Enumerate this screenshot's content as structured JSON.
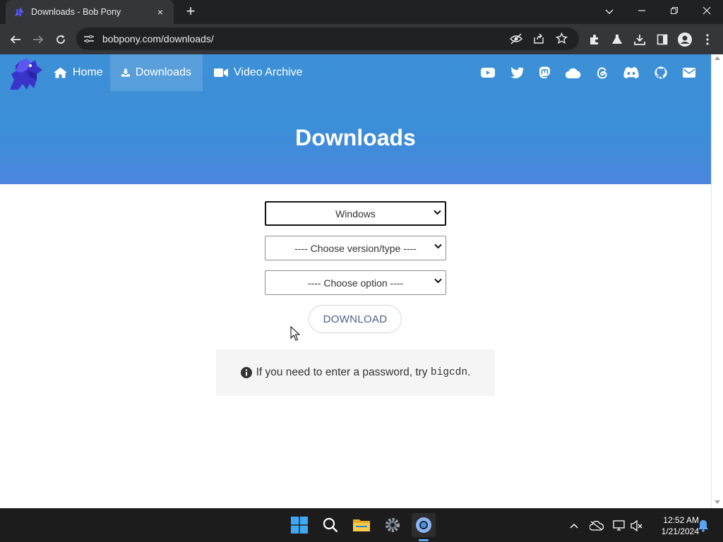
{
  "browser": {
    "tab_title": "Downloads - Bob Pony",
    "tab_close": "×",
    "new_tab": "+",
    "url": "bobpony.com/downloads/",
    "window_controls": {
      "minimize": "—",
      "restore": "❐",
      "close": "✕",
      "tab_search": "⌄"
    }
  },
  "site": {
    "nav": [
      {
        "label": "Home",
        "icon": "home-icon"
      },
      {
        "label": "Downloads",
        "icon": "download-icon",
        "active": true
      },
      {
        "label": "Video Archive",
        "icon": "video-camera-icon"
      }
    ],
    "social_icons": [
      "youtube-icon",
      "twitter-icon",
      "mastodon-icon",
      "cloud-icon",
      "threads-icon",
      "discord-icon",
      "github-icon",
      "mail-icon"
    ],
    "hero_title": "Downloads",
    "accent_color": "#3d8ed7"
  },
  "form": {
    "os_select": "Windows",
    "version_select": "---- Choose version/type ----",
    "option_select": "---- Choose option ----",
    "download_label": "DOWNLOAD",
    "notice_text": "If you need to enter a password, try ",
    "notice_code": "bigcdn",
    "notice_end": "."
  },
  "taskbar": {
    "apps": [
      "windows-start-icon",
      "search-icon",
      "file-explorer-icon",
      "settings-icon",
      "chrome-icon"
    ],
    "time": "12:52 AM",
    "date": "1/21/2024"
  }
}
